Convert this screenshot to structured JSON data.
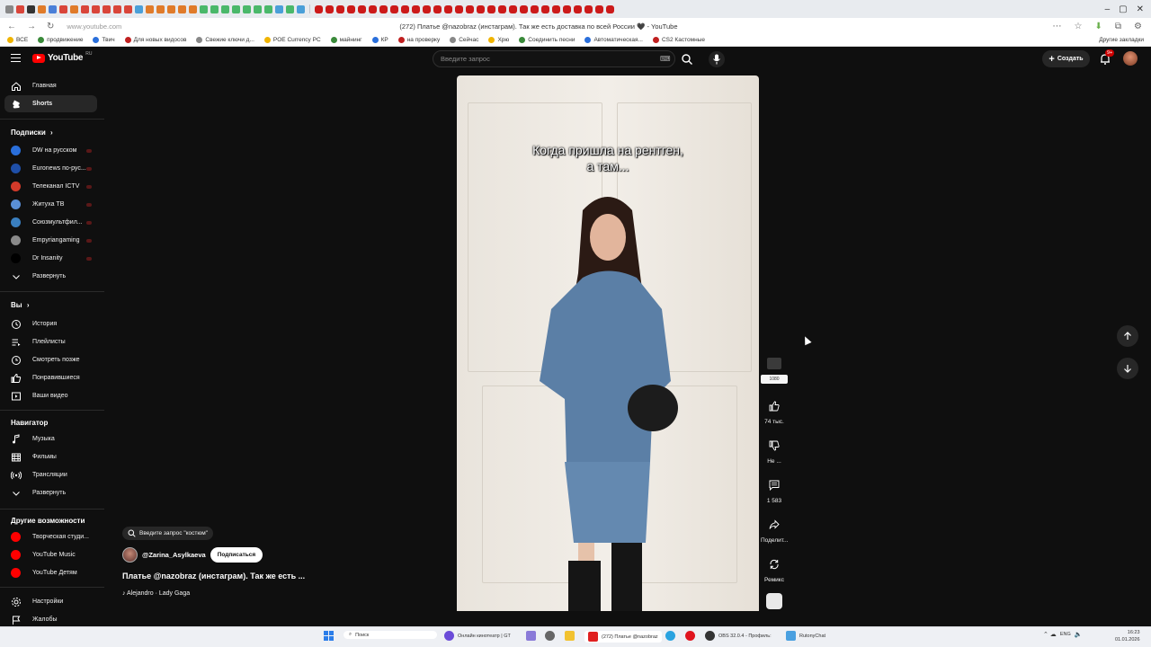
{
  "browser": {
    "url": "www.youtube.com",
    "page_title": "(272) Платье @nazobraz (инстаграм). Так же есть доставка по всей России 🖤 - YouTube",
    "bookmarks": [
      "ВСЕ",
      "продвижение",
      "Твич",
      "Для новых видосов",
      "Свежие ключи д...",
      "POE Currency PC",
      "майнинг",
      "КР",
      "на проверку",
      "Сейчас",
      "Хрю",
      "Соединить песни",
      "Автоматическая...",
      "CS2 Кастомные"
    ],
    "other_bookmarks": "Другие закладки"
  },
  "header": {
    "logo_text": "YouTube",
    "country_code": "RU",
    "search_placeholder": "Введите запрос",
    "create_label": "Создать",
    "notif_count": "9+"
  },
  "sidebar": {
    "main": [
      {
        "label": "Главная",
        "icon": "home-icon"
      },
      {
        "label": "Shorts",
        "icon": "shorts-icon",
        "active": true
      }
    ],
    "subs_header": "Подписки",
    "subs_arrow": "›",
    "subscriptions": [
      {
        "label": "DW на русском",
        "color": "#2a6fdb"
      },
      {
        "label": "Euronews по-рус...",
        "color": "#1f4fa8"
      },
      {
        "label": "Телеканал ICTV",
        "color": "#d23a2a"
      },
      {
        "label": "Житуха ТВ",
        "color": "#5a8fd6"
      },
      {
        "label": "Союзмультфил...",
        "color": "#3a7fc0"
      },
      {
        "label": "Empyriangaming",
        "color": "#8a8a8a"
      },
      {
        "label": "Dr Insanity",
        "color": "#000000"
      }
    ],
    "expand_label": "Развернуть",
    "you_header": "Вы",
    "you_items": [
      {
        "label": "История",
        "icon": "history-icon"
      },
      {
        "label": "Плейлисты",
        "icon": "playlists-icon"
      },
      {
        "label": "Смотреть позже",
        "icon": "watch-later-icon"
      },
      {
        "label": "Понравившиеся",
        "icon": "like-icon"
      },
      {
        "label": "Ваши видео",
        "icon": "your-videos-icon"
      }
    ],
    "nav_header": "Навигатор",
    "nav_items": [
      {
        "label": "Музыка",
        "icon": "music-icon"
      },
      {
        "label": "Фильмы",
        "icon": "movies-icon"
      },
      {
        "label": "Трансляции",
        "icon": "live-icon"
      }
    ],
    "nav_expand": "Развернуть",
    "more_header": "Другие возможности",
    "more_items": [
      {
        "label": "Творческая студи...",
        "color": "#ff0000"
      },
      {
        "label": "YouTube Music",
        "color": "#ff0000"
      },
      {
        "label": "YouTube Детям",
        "color": "#ff0000"
      }
    ],
    "settings_label": "Настройки",
    "report_label": "Жалобы"
  },
  "short": {
    "caption_line1": "Когда пришла на рентген,",
    "caption_line2": "а там...",
    "search_hint": "Введите запрос \"костюм\"",
    "channel": "@Zarina_Asylkaeva",
    "subscribe": "Подписаться",
    "title": "Платье @nazobraz (инстаграм). Так же есть ...",
    "music": "♪ Alejandro · Lady Gaga"
  },
  "actions": {
    "quality": "1080",
    "likes": "74 тыс.",
    "dislike": "Не ...",
    "comments": "1 583",
    "share": "Поделит...",
    "remix": "Ремикс"
  },
  "taskbar": {
    "search": "Поиск",
    "items": [
      "Онлайн кинотеатр | GT",
      "(272) Платье @nazobraz",
      "OBS 32.0.4 - Профиль:",
      "RutonyChat"
    ],
    "lang": "ENG",
    "time": "16:23",
    "date": "01.01.2026"
  }
}
